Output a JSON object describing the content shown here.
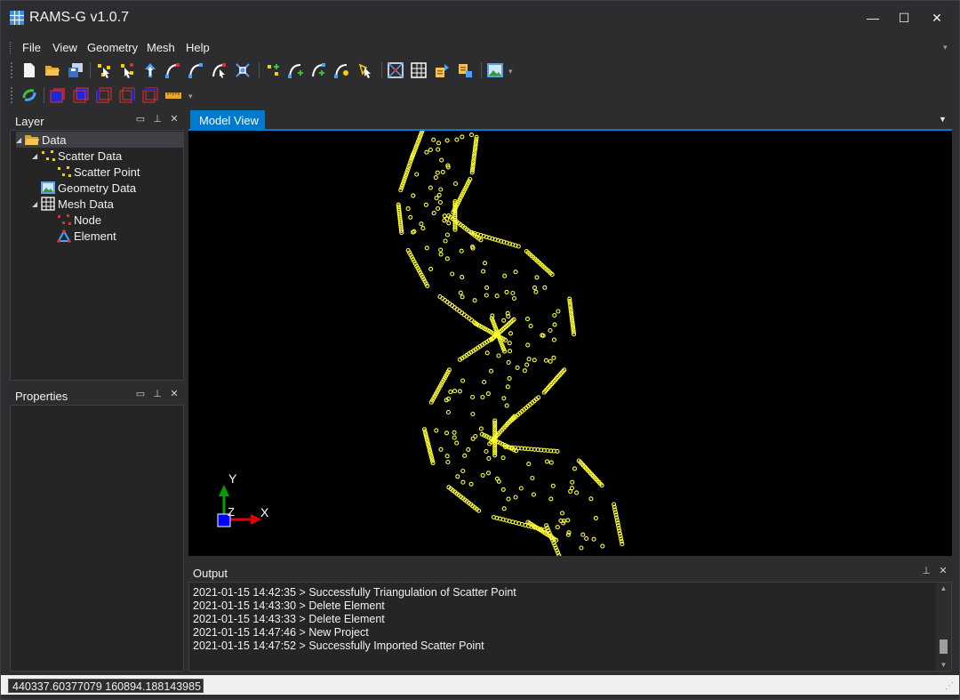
{
  "window": {
    "title": "RAMS-G v1.0.7",
    "minimize_glyph": "—",
    "maximize_glyph": "☐",
    "close_glyph": "✕"
  },
  "menu": {
    "items": [
      "File",
      "View",
      "Geometry",
      "Mesh",
      "Help"
    ]
  },
  "toolbar1": {
    "icons": [
      "new-file-icon",
      "open-folder-icon",
      "save-icon",
      "scatter-select-icon",
      "scatter-move-icon",
      "arrow-up-icon",
      "polyline-select-icon",
      "arc-icon",
      "arc-select-icon",
      "node-delete-icon",
      "point-add-icon",
      "line-add-icon",
      "curve-add-icon",
      "curve-edit-icon",
      "mesh-select-icon",
      "triangulate-icon",
      "grid-mesh-icon",
      "mesh-export-icon",
      "mesh-import-icon",
      "geometry-image-icon"
    ]
  },
  "toolbar2": {
    "icons": [
      "refresh-icon",
      "view-front-icon",
      "view-back-icon",
      "view-left-icon",
      "view-right-icon",
      "view-top-icon",
      "ruler-icon"
    ]
  },
  "layer_panel": {
    "title": "Layer",
    "tree": [
      {
        "label": "Data",
        "icon": "folder-icon"
      },
      {
        "label": "Scatter Data",
        "icon": "scatter-data-icon"
      },
      {
        "label": "Scatter Point",
        "icon": "scatter-point-icon"
      },
      {
        "label": "Geometry Data",
        "icon": "geometry-data-icon"
      },
      {
        "label": "Mesh Data",
        "icon": "mesh-data-icon"
      },
      {
        "label": "Node",
        "icon": "node-icon"
      },
      {
        "label": "Element",
        "icon": "element-icon"
      }
    ]
  },
  "properties_panel": {
    "title": "Properties"
  },
  "document": {
    "tab_label": "Model View",
    "axes": {
      "x": "X",
      "y": "Y",
      "z": "Z"
    },
    "colors": {
      "points": "#ffff33",
      "background": "#000000",
      "x_axis": "#e00000",
      "y_axis": "#00a000",
      "z_axis": "#0000ff"
    }
  },
  "output_panel": {
    "title": "Output",
    "lines": [
      "2021-01-15 14:42:35 > Successfully Triangulation of Scatter Point",
      "2021-01-15 14:43:30 > Delete Element",
      "2021-01-15 14:43:33 > Delete Element",
      "2021-01-15 14:47:46 > New Project",
      "2021-01-15 14:47:52 > Successfully Imported Scatter Point"
    ],
    "scroll_position": 0.93
  },
  "status": {
    "coordinates": "440337.60377079 160894.188143985"
  },
  "colors": {
    "accent": "#007acc",
    "chrome": "#2d2d30",
    "panel": "#252526"
  }
}
